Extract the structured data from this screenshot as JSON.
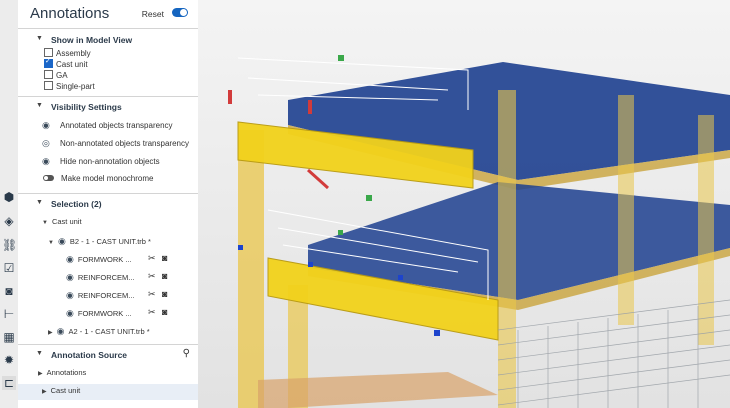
{
  "panel": {
    "title": "Annotations",
    "reset_label": "Reset"
  },
  "show_in_model_view": {
    "title": "Show in Model View",
    "options": [
      {
        "label": "Assembly",
        "checked": false
      },
      {
        "label": "Cast unit",
        "checked": true
      },
      {
        "label": "GA",
        "checked": false
      },
      {
        "label": "Single-part",
        "checked": false
      }
    ]
  },
  "visibility_settings": {
    "title": "Visibility Settings",
    "items": [
      {
        "label": "Annotated objects transparency",
        "icon": "eye-icon"
      },
      {
        "label": "Non-annotated objects transparency",
        "icon": "eye-outline-icon"
      },
      {
        "label": "Hide non-annotation objects",
        "icon": "eye-icon"
      },
      {
        "label": "Make model monochrome",
        "icon": "toggle-icon"
      }
    ]
  },
  "selection": {
    "title": "Selection (2)",
    "group_label": "Cast unit",
    "items": [
      {
        "label": "B2 - 1 - CAST UNIT.trb *",
        "children": [
          {
            "label": "FORMWORK ..."
          },
          {
            "label": "REINFORCEM..."
          },
          {
            "label": "REINFORCEM..."
          },
          {
            "label": "FORMWORK ..."
          }
        ]
      },
      {
        "label": "A2 - 1 - CAST UNIT.trb *",
        "children": []
      }
    ]
  },
  "annotation_source": {
    "title": "Annotation Source",
    "items": [
      {
        "label": "Annotations"
      },
      {
        "label": "Cast unit"
      }
    ]
  },
  "toolbar_icons": [
    "cube-icon",
    "layers-icon",
    "link-icon",
    "checklist-icon",
    "camera-icon",
    "hierarchy-icon",
    "table-icon",
    "gear-icon",
    "annotation-icon"
  ],
  "colors": {
    "accent": "#1565c0",
    "beam": "#f2d21b",
    "slab": "#1d3f8f"
  }
}
